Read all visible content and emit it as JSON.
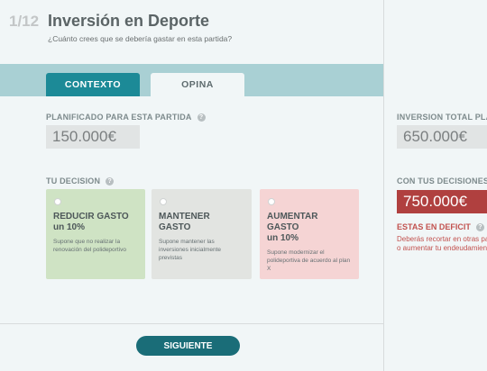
{
  "header": {
    "step": "1/12",
    "title": "Inversión en Deporte",
    "subtitle": "¿Cuánto crees que se debería gastar en esta partida?"
  },
  "tabs": [
    {
      "label": "CONTEXTO",
      "active": true
    },
    {
      "label": "OPINA",
      "active": false
    }
  ],
  "planned": {
    "label": "PLANIFICADO PARA ESTA PARTIDA",
    "value": "150.000€"
  },
  "decision": {
    "label": "TU DECISION",
    "options": [
      {
        "title": "REDUCIR GASTO",
        "subtitle": "un 10%",
        "description": "Supone que no realizar la renovación del polideportivo",
        "color": "#cfe3c4"
      },
      {
        "title": "MANTENER GASTO",
        "subtitle": "",
        "description": "Supone mantener las inversiones inicialmente previstas",
        "color": "#e2e4e1"
      },
      {
        "title": "AUMENTAR GASTO",
        "subtitle": "un 10%",
        "description": "Supone modernizar el polideportiva de acuerdo al plan X",
        "color": "#f5d4d4"
      }
    ]
  },
  "next_button": "SIGUIENTE",
  "summary": {
    "total_label": "INVERSION TOTAL PLANI",
    "total_value": "650.000€",
    "yours_label": "CON TUS DECISIONES",
    "yours_value": "750.000€",
    "deficit_label": "ESTAS EN DEFICIT",
    "deficit_desc_1": "Deberás recortar en otras pa",
    "deficit_desc_2": "o aumentar tu endeudamien"
  },
  "help_icon": "?",
  "colors": {
    "primary": "#1c8a97",
    "button": "#1a6d78",
    "tabbar": "#a9d0d4",
    "deficit": "#b0403f"
  }
}
